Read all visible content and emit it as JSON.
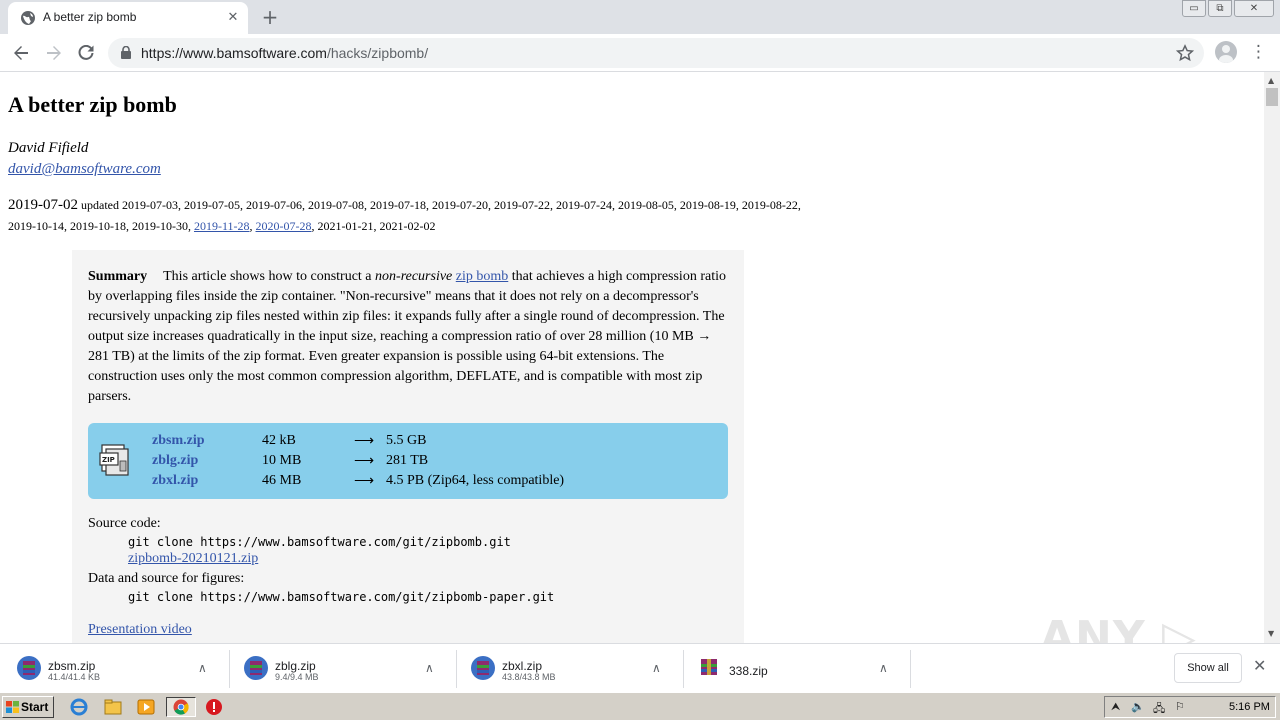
{
  "browser": {
    "tab_title": "A better zip bomb",
    "tab_close": "✕",
    "new_tab": "+",
    "window_buttons": [
      "▭",
      "⧉",
      "✕"
    ],
    "url_host": "https://www.bamsoftware.com",
    "url_path": "/hacks/zipbomb/",
    "icons": {
      "back": "back-arrow-icon",
      "forward": "forward-arrow-icon",
      "reload": "reload-icon",
      "lock": "lock-icon",
      "star": "star-icon",
      "profile": "profile-avatar-icon",
      "menu": "kebab-menu-icon"
    }
  },
  "page": {
    "title": "A better zip bomb",
    "author": "David Fifield",
    "email": "david@bamsoftware.com",
    "date": "2019-07-02",
    "updated_label": "updated",
    "updated_plain_1": "2019-07-03, 2019-07-05, 2019-07-06, 2019-07-08, 2019-07-18, 2019-07-20, 2019-07-22, 2019-07-24, 2019-08-05, 2019-08-19, 2019-08-22, 2019-10-14, 2019-10-18, 2019-10-30,",
    "updated_link_1": "2019-11-28",
    "updated_link_2": "2020-07-28",
    "updated_plain_2": ", 2021-01-21, 2021-02-02",
    "summary": {
      "heading": "Summary",
      "text_1": "This article shows how to construct a ",
      "text_em": "non-recursive",
      "text_2": " ",
      "link": "zip bomb",
      "text_3": " that achieves a high compression ratio by overlapping files inside the zip container. \"Non-recursive\" means that it does not rely on a decompressor's recursively unpacking zip files nested within zip files: it expands fully after a single round of decompression. The output size increases quadratically in the input size, reaching a compression ratio of over 28 million (10 MB → 281 TB) at the limits of the zip format. Even greater expansion is possible using 64-bit extensions. The construction uses only the most common compression algorithm, DEFLATE, and is compatible with most zip parsers."
    },
    "files": [
      {
        "name": "zbsm.zip",
        "size": "42 kB",
        "arrow": "⟶",
        "output": "5.5 GB"
      },
      {
        "name": "zblg.zip",
        "size": "10 MB",
        "arrow": "⟶",
        "output": "281 TB"
      },
      {
        "name": "zbxl.zip",
        "size": "46 MB",
        "arrow": "⟶",
        "output": "4.5 PB (Zip64, less compatible)"
      }
    ],
    "source_label": "Source code:",
    "source_cmd": "git clone https://www.bamsoftware.com/git/zipbomb.git",
    "source_link": "zipbomb-20210121.zip",
    "data_label": "Data and source for figures:",
    "data_cmd": "git clone https://www.bamsoftware.com/git/zipbomb-paper.git",
    "video_link": "Presentation video"
  },
  "watermark": "ANY ▷ RUN",
  "downloads": {
    "items": [
      {
        "name": "zbsm.zip",
        "size": "41.4/41.4 KB"
      },
      {
        "name": "zblg.zip",
        "size": "9.4/9.4 MB"
      },
      {
        "name": "zbxl.zip",
        "size": "43.8/43.8 MB"
      },
      {
        "name": "338.zip",
        "size": ""
      }
    ],
    "chevron": "∧",
    "show_all": "Show all",
    "close": "✕"
  },
  "taskbar": {
    "start_label": "Start",
    "clock": "5:16 PM"
  }
}
